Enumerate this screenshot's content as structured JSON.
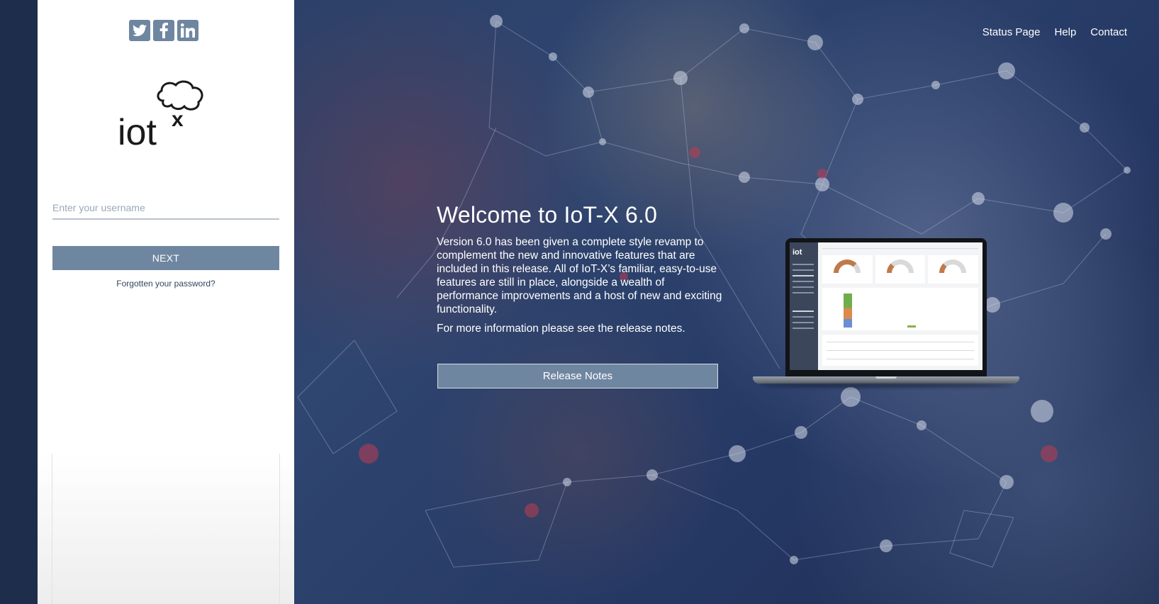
{
  "social_icons": [
    "twitter-icon",
    "facebook-icon",
    "linkedin-icon"
  ],
  "logo": {
    "text_main": "iot",
    "text_sup": "x"
  },
  "login": {
    "username_placeholder": "Enter your username",
    "next_label": "NEXT",
    "forgot_label": "Forgotten your password?"
  },
  "nav": {
    "status": "Status Page",
    "help": "Help",
    "contact": "Contact"
  },
  "hero": {
    "title": "Welcome to IoT-X 6.0",
    "body": "Version 6.0 has been given a complete style revamp to complement the new and innovative features that are included in this release. All of IoT-X’s familiar, easy-to-use features are still in place, alongside a wealth of performance improvements and a host of new and exciting functionality.",
    "more_info": "For more information please see the release notes.",
    "button_label": "Release Notes"
  },
  "laptop_preview": {
    "logo": "iot"
  },
  "colors": {
    "accent": "#6f86a0",
    "background": "#25355a",
    "panel": "#ffffff"
  }
}
